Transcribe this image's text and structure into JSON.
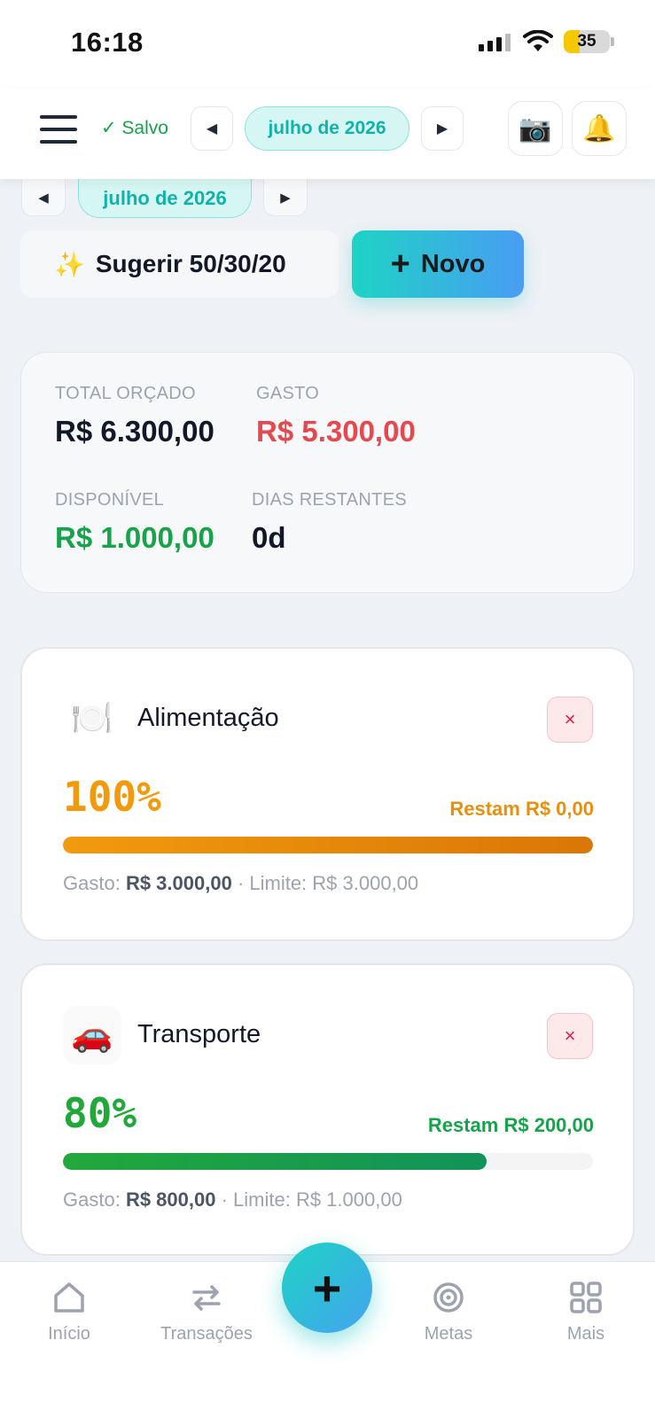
{
  "status_bar": {
    "time": "16:18",
    "battery": "35",
    "battery_level": 0.35
  },
  "header": {
    "saved_label": "✓ Salvo",
    "prev_label": "◀",
    "month_label": "julho de 2026",
    "next_label": "▶",
    "camera_icon": "📷",
    "bell_icon": "🔔"
  },
  "subnav": {
    "prev_label": "◀",
    "month_label": "julho de 2026",
    "next_label": "▶"
  },
  "actions": {
    "suggest_icon": "✨",
    "suggest_label": "Sugerir 50/30/20",
    "new_plus": "+",
    "new_label": "Novo"
  },
  "summary": {
    "total_label": "TOTAL ORÇADO",
    "total_value": "R$ 6.300,00",
    "spent_label": "GASTO",
    "spent_value": "R$ 5.300,00",
    "available_label": "DISPONÍVEL",
    "available_value": "R$ 1.000,00",
    "days_label": "DIAS RESTANTES",
    "days_value": "0d"
  },
  "categories": [
    {
      "icon": "🍽️",
      "name": "Alimentação",
      "delete_label": "×",
      "percent": "100%",
      "progress": 1.0,
      "remaining": "Restam R$ 0,00",
      "spent_label": "Gasto:",
      "spent_value": "R$ 3.000,00",
      "limit_text": "· Limite: R$ 3.000,00",
      "color": "#f29a0e"
    },
    {
      "icon": "🚗",
      "name": "Transporte",
      "delete_label": "×",
      "percent": "80%",
      "progress": 0.8,
      "remaining": "Restam R$ 200,00",
      "spent_label": "Gasto:",
      "spent_value": "R$ 800,00",
      "limit_text": "· Limite: R$ 1.000,00",
      "color": "#22a83a"
    }
  ],
  "bottom_nav": {
    "home_label": "Início",
    "transactions_label": "Transações",
    "fab_label": "+",
    "goals_label": "Metas",
    "more_label": "Mais"
  }
}
